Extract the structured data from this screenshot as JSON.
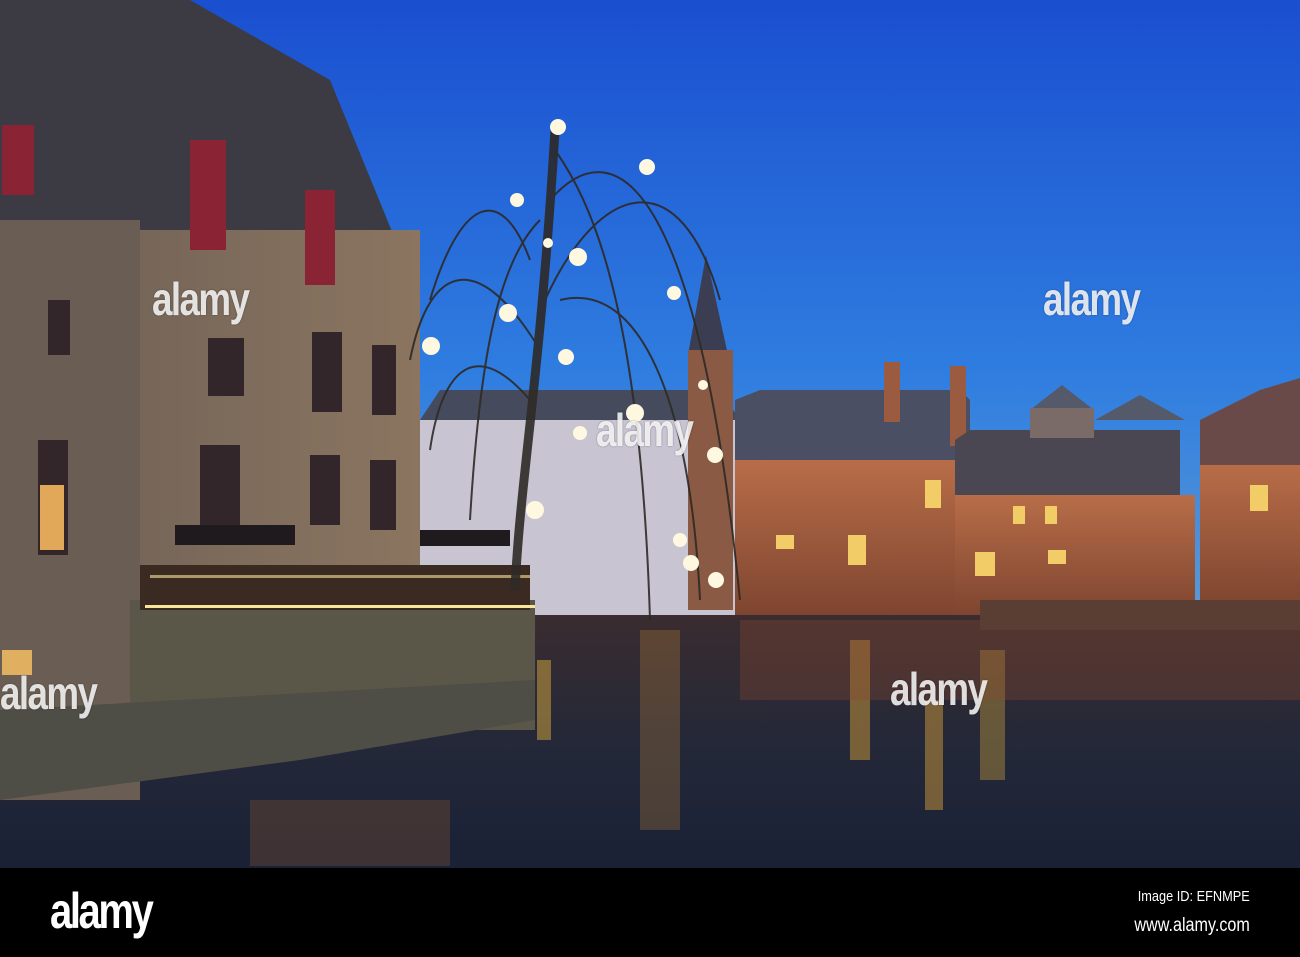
{
  "photo": {
    "subject": "Canal with illuminated weeping willow and brick buildings at dusk",
    "watermark": "alamy"
  },
  "footer": {
    "logo": "alamy",
    "image_id": "Image ID: EFNMPE",
    "url": "www.alamy.com"
  },
  "colors": {
    "sky_top": "#1f5fd8",
    "sky_bottom": "#4a8ed8",
    "brick": "#a0603e",
    "water": "#1d2230"
  }
}
